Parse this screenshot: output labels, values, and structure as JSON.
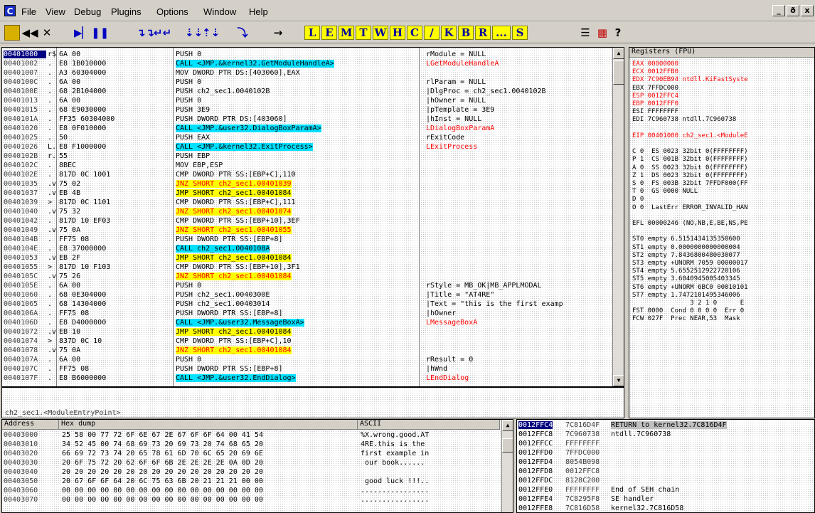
{
  "menu": {
    "icon": "C",
    "items": [
      "File",
      "View",
      "Debug",
      "Plugins",
      "Options",
      "Window",
      "Help"
    ],
    "window_buttons": [
      "_",
      "ð",
      "x"
    ]
  },
  "toolbar": {
    "icons": [
      "open-icon",
      "restart-icon",
      "close-icon",
      "run-icon",
      "pause-icon",
      "step-into-icon",
      "step-over-icon",
      "trace-into-icon",
      "trace-over-icon",
      "execute-till-return-icon",
      "goto-icon"
    ],
    "letters": [
      "L",
      "E",
      "M",
      "T",
      "W",
      "H",
      "C",
      "/",
      "K",
      "B",
      "R",
      "...",
      "S"
    ],
    "extra": [
      "?"
    ]
  },
  "disasm_rows": [
    {
      "addr": "00401000",
      "m": "r$",
      "hex": "6A 00",
      "dis": "PUSH 0",
      "cmt": "rModule = NULL",
      "cls": "",
      "ccls": ""
    },
    {
      "addr": "00401002",
      "m": ".",
      "hex": "E8 1B010000",
      "dis": "CALL <JMP.&kernel32.GetModuleHandleA>",
      "cmt": "LGetModuleHandleA",
      "cls": "call",
      "ccls": "red"
    },
    {
      "addr": "00401007",
      "m": ".",
      "hex": "A3 60304000",
      "dis": "MOV DWORD PTR DS:[403060],EAX",
      "cmt": "",
      "cls": "",
      "ccls": ""
    },
    {
      "addr": "0040100C",
      "m": ".",
      "hex": "6A 00",
      "dis": "PUSH 0",
      "cmt": "rlParam = NULL",
      "cls": "",
      "ccls": ""
    },
    {
      "addr": "0040100E",
      "m": ".",
      "hex": "68 2B104000",
      "dis": "PUSH ch2_sec1.0040102B",
      "cmt": "|DlgProc = ch2_sec1.0040102B",
      "cls": "",
      "ccls": ""
    },
    {
      "addr": "00401013",
      "m": ".",
      "hex": "6A 00",
      "dis": "PUSH 0",
      "cmt": "|hOwner = NULL",
      "cls": "",
      "ccls": ""
    },
    {
      "addr": "00401015",
      "m": ".",
      "hex": "68 E9030000",
      "dis": "PUSH 3E9",
      "cmt": "|pTemplate = 3E9",
      "cls": "",
      "ccls": ""
    },
    {
      "addr": "0040101A",
      "m": ".",
      "hex": "FF35 60304000",
      "dis": "PUSH DWORD PTR DS:[403060]",
      "cmt": "|hInst = NULL",
      "cls": "",
      "ccls": ""
    },
    {
      "addr": "00401020",
      "m": ".",
      "hex": "E8 0F010000",
      "dis": "CALL <JMP.&user32.DialogBoxParamA>",
      "cmt": "LDialogBoxParamA",
      "cls": "call",
      "ccls": "red"
    },
    {
      "addr": "00401025",
      "m": ".",
      "hex": "50",
      "dis": "PUSH EAX",
      "cmt": "rExitCode",
      "cls": "",
      "ccls": ""
    },
    {
      "addr": "00401026",
      "m": "L.",
      "hex": "E8 F1000000",
      "dis": "CALL <JMP.&kernel32.ExitProcess>",
      "cmt": "LExitProcess",
      "cls": "call",
      "ccls": "red"
    },
    {
      "addr": "0040102B",
      "m": "r.",
      "hex": "55",
      "dis": "PUSH EBP",
      "cmt": "",
      "cls": "",
      "ccls": ""
    },
    {
      "addr": "0040102C",
      "m": ".",
      "hex": "8BEC",
      "dis": "MOV EBP,ESP",
      "cmt": "",
      "cls": "",
      "ccls": ""
    },
    {
      "addr": "0040102E",
      "m": ".",
      "hex": "817D 0C 1001",
      "dis": "CMP DWORD PTR SS:[EBP+C],110",
      "cmt": "",
      "cls": "",
      "ccls": ""
    },
    {
      "addr": "00401035",
      "m": ".v",
      "hex": "75 02",
      "dis": "JNZ SHORT ch2_sec1.00401039",
      "cmt": "",
      "cls": "jcc",
      "ccls": ""
    },
    {
      "addr": "00401037",
      "m": ".v",
      "hex": "EB 4B",
      "dis": "JMP SHORT ch2_sec1.00401084",
      "cmt": "",
      "cls": "jmp",
      "ccls": ""
    },
    {
      "addr": "00401039",
      "m": ">",
      "hex": "817D 0C 1101",
      "dis": "CMP DWORD PTR SS:[EBP+C],111",
      "cmt": "",
      "cls": "",
      "ccls": ""
    },
    {
      "addr": "00401040",
      "m": ".v",
      "hex": "75 32",
      "dis": "JNZ SHORT ch2_sec1.00401074",
      "cmt": "",
      "cls": "jcc",
      "ccls": ""
    },
    {
      "addr": "00401042",
      "m": ".",
      "hex": "817D 10 EF03",
      "dis": "CMP DWORD PTR SS:[EBP+10],3EF",
      "cmt": "",
      "cls": "",
      "ccls": ""
    },
    {
      "addr": "00401049",
      "m": ".v",
      "hex": "75 0A",
      "dis": "JNZ SHORT ch2_sec1.00401055",
      "cmt": "",
      "cls": "jcc",
      "ccls": ""
    },
    {
      "addr": "0040104B",
      "m": ".",
      "hex": "FF75 08",
      "dis": "PUSH DWORD PTR SS:[EBP+8]",
      "cmt": "",
      "cls": "",
      "ccls": ""
    },
    {
      "addr": "0040104E",
      "m": ".",
      "hex": "E8 37000000",
      "dis": "CALL ch2_sec1.0040108A",
      "cmt": "",
      "cls": "call",
      "ccls": ""
    },
    {
      "addr": "00401053",
      "m": ".v",
      "hex": "EB 2F",
      "dis": "JMP SHORT ch2_sec1.00401084",
      "cmt": "",
      "cls": "jmp",
      "ccls": ""
    },
    {
      "addr": "00401055",
      "m": ">",
      "hex": "817D 10 F103",
      "dis": "CMP DWORD PTR SS:[EBP+10],3F1",
      "cmt": "",
      "cls": "",
      "ccls": ""
    },
    {
      "addr": "0040105C",
      "m": ".v",
      "hex": "75 26",
      "dis": "JNZ SHORT ch2_sec1.00401084",
      "cmt": "",
      "cls": "jcc",
      "ccls": ""
    },
    {
      "addr": "0040105E",
      "m": ".",
      "hex": "6A 00",
      "dis": "PUSH 0",
      "cmt": "rStyle = MB_OK|MB_APPLMODAL",
      "cls": "",
      "ccls": ""
    },
    {
      "addr": "00401060",
      "m": ".",
      "hex": "68 0E304000",
      "dis": "PUSH ch2_sec1.0040300E",
      "cmt": "|Title = \"AT4RE\"",
      "cls": "",
      "ccls": ""
    },
    {
      "addr": "00401065",
      "m": ".",
      "hex": "68 14304000",
      "dis": "PUSH ch2_sec1.00403014",
      "cmt": "|Text = \"this is the first examp",
      "cls": "",
      "ccls": ""
    },
    {
      "addr": "0040106A",
      "m": ".",
      "hex": "FF75 08",
      "dis": "PUSH DWORD PTR SS:[EBP+8]",
      "cmt": "|hOwner",
      "cls": "",
      "ccls": ""
    },
    {
      "addr": "0040106D",
      "m": ".",
      "hex": "E8 D4000000",
      "dis": "CALL <JMP.&user32.MessageBoxA>",
      "cmt": "LMessageBoxA",
      "cls": "call",
      "ccls": "red"
    },
    {
      "addr": "00401072",
      "m": ".v",
      "hex": "EB 10",
      "dis": "JMP SHORT ch2_sec1.00401084",
      "cmt": "",
      "cls": "jmp",
      "ccls": ""
    },
    {
      "addr": "00401074",
      "m": ">",
      "hex": "837D 0C 10",
      "dis": "CMP DWORD PTR SS:[EBP+C],10",
      "cmt": "",
      "cls": "",
      "ccls": ""
    },
    {
      "addr": "00401078",
      "m": ".v",
      "hex": "75 0A",
      "dis": "JNZ SHORT ch2_sec1.00401084",
      "cmt": "",
      "cls": "jcc",
      "ccls": ""
    },
    {
      "addr": "0040107A",
      "m": ".",
      "hex": "6A 00",
      "dis": "PUSH 0",
      "cmt": "rResult = 0",
      "cls": "",
      "ccls": ""
    },
    {
      "addr": "0040107C",
      "m": ".",
      "hex": "FF75 08",
      "dis": "PUSH DWORD PTR SS:[EBP+8]",
      "cmt": "|hWnd",
      "cls": "",
      "ccls": ""
    },
    {
      "addr": "0040107F",
      "m": ".",
      "hex": "E8 B6000000",
      "dis": "CALL <JMP.&user32.EndDialog>",
      "cmt": "LEndDialog",
      "cls": "call",
      "ccls": "red"
    }
  ],
  "info_line": "ch2_sec1.<ModuleEntryPoint>",
  "registers": {
    "title": "Registers (FPU)",
    "lines": [
      {
        "t": "EAX 00000000",
        "c": "red"
      },
      {
        "t": "ECX 0012FFB0",
        "c": "red"
      },
      {
        "t": "EDX 7C90EB94 ntdll.KiFastSyste",
        "c": "red"
      },
      {
        "t": "EBX 7FFDC000",
        "c": ""
      },
      {
        "t": "ESP 0012FFC4",
        "c": "red"
      },
      {
        "t": "EBP 0012FFF0",
        "c": "red"
      },
      {
        "t": "ESI FFFFFFFF",
        "c": ""
      },
      {
        "t": "EDI 7C960738 ntdll.7C960738",
        "c": ""
      },
      {
        "t": "",
        "c": ""
      },
      {
        "t": "EIP 00401000 ch2_sec1.<ModuleE",
        "c": "red"
      },
      {
        "t": "",
        "c": ""
      },
      {
        "t": "C 0  ES 0023 32bit 0(FFFFFFFF)",
        "c": ""
      },
      {
        "t": "P 1  CS 001B 32bit 0(FFFFFFFF)",
        "c": ""
      },
      {
        "t": "A 0  SS 0023 32bit 0(FFFFFFFF)",
        "c": ""
      },
      {
        "t": "Z 1  DS 0023 32bit 0(FFFFFFFF)",
        "c": ""
      },
      {
        "t": "S 0  FS 003B 32bit 7FFDF000(FF",
        "c": ""
      },
      {
        "t": "T 0  GS 0000 NULL",
        "c": ""
      },
      {
        "t": "D 0",
        "c": ""
      },
      {
        "t": "O 0  LastErr ERROR_INVALID_HAN",
        "c": ""
      },
      {
        "t": "",
        "c": ""
      },
      {
        "t": "EFL 00000246 (NO,NB,E,BE,NS,PE",
        "c": ""
      },
      {
        "t": "",
        "c": ""
      },
      {
        "t": "ST0 empty 6.5151434135350600",
        "c": ""
      },
      {
        "t": "ST1 empty 0.0000000000000004",
        "c": ""
      },
      {
        "t": "ST2 empty 7.8436800480030077",
        "c": ""
      },
      {
        "t": "ST3 empty +UNORM 7059 00000017",
        "c": ""
      },
      {
        "t": "ST4 empty 5.6552512922720106",
        "c": ""
      },
      {
        "t": "ST5 empty 3.6040945005403345",
        "c": ""
      },
      {
        "t": "ST6 empty +UNORM 6BC0 00010101",
        "c": ""
      },
      {
        "t": "ST7 empty 1.7472101495346006",
        "c": ""
      },
      {
        "t": "               3 2 1 0      E",
        "c": ""
      },
      {
        "t": "FST 0000  Cond 0 0 0 0  Err 0",
        "c": ""
      },
      {
        "t": "FCW 027F  Prec NEAR,53  Mask",
        "c": ""
      }
    ]
  },
  "dump": {
    "headers": [
      "Address",
      "Hex dump",
      "ASCII"
    ],
    "rows": [
      {
        "addr": "00403000",
        "hex": "25 58 00 77 72 6F 6E 67 2E 67 6F 6F 64 00 41 54",
        "ascii": "%X.wrong.good.AT"
      },
      {
        "addr": "00403010",
        "hex": "34 52 45 00 74 68 69 73 20 69 73 20 74 68 65 20",
        "ascii": "4RE.this is the"
      },
      {
        "addr": "00403020",
        "hex": "66 69 72 73 74 20 65 78 61 6D 70 6C 65 20 69 6E",
        "ascii": "first example in"
      },
      {
        "addr": "00403030",
        "hex": "20 6F 75 72 20 62 6F 6F 6B 2E 2E 2E 2E 0A 0D 20",
        "ascii": " our book......"
      },
      {
        "addr": "00403040",
        "hex": "20 20 20 20 20 20 20 20 20 20 20 20 20 20 20 20",
        "ascii": ""
      },
      {
        "addr": "00403050",
        "hex": "20 67 6F 6F 64 20 6C 75 63 6B 20 21 21 21 00 00",
        "ascii": " good luck !!!.."
      },
      {
        "addr": "00403060",
        "hex": "00 00 00 00 00 00 00 00 00 00 00 00 00 00 00 00",
        "ascii": "................"
      },
      {
        "addr": "00403070",
        "hex": "00 00 00 00 00 00 00 00 00 00 00 00 00 00 00 00",
        "ascii": "................"
      }
    ]
  },
  "stack": {
    "rows": [
      {
        "addr": "0012FFC4",
        "val": "7C816D4F",
        "cmt": "RETURN to kernel32.7C816D4F",
        "sel": true
      },
      {
        "addr": "0012FFC8",
        "val": "7C960738",
        "cmt": "ntdll.7C960738",
        "sel": false
      },
      {
        "addr": "0012FFCC",
        "val": "FFFFFFFF",
        "cmt": "",
        "sel": false
      },
      {
        "addr": "0012FFD0",
        "val": "7FFDC000",
        "cmt": "",
        "sel": false
      },
      {
        "addr": "0012FFD4",
        "val": "8054B098",
        "cmt": "",
        "sel": false
      },
      {
        "addr": "0012FFD8",
        "val": "0012FFC8",
        "cmt": "",
        "sel": false
      },
      {
        "addr": "0012FFDC",
        "val": "8128C200",
        "cmt": "",
        "sel": false
      },
      {
        "addr": "0012FFE0",
        "val": "FFFFFFFF",
        "cmt": "End of SEH chain",
        "sel": false
      },
      {
        "addr": "0012FFE4",
        "val": "7C8295F8",
        "cmt": "SE handler",
        "sel": false
      },
      {
        "addr": "0012FFE8",
        "val": "7C816D58",
        "cmt": "kernel32.7C816D58",
        "sel": false
      }
    ]
  }
}
